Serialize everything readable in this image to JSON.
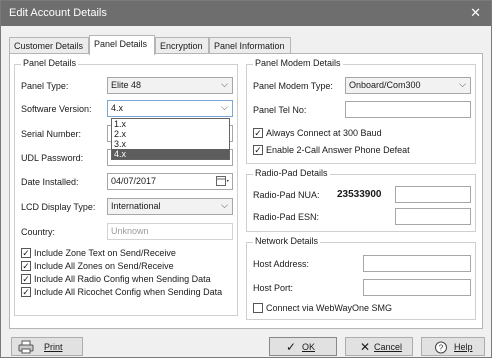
{
  "window": {
    "title": "Edit Account Details",
    "close_glyph": "✕"
  },
  "tabs": [
    {
      "label": "Customer Details"
    },
    {
      "label": "Panel Details"
    },
    {
      "label": "Encryption"
    },
    {
      "label": "Panel Information"
    }
  ],
  "panel_details": {
    "group_title": "Panel Details",
    "panel_type": {
      "label": "Panel Type:",
      "value": "Elite 48"
    },
    "software_version": {
      "label": "Software Version:",
      "value": "4.x",
      "options": [
        "1.x",
        "2.x",
        "3.x",
        "4.x"
      ],
      "selected": "4.x"
    },
    "serial_number": {
      "label": "Serial Number:"
    },
    "udl_password": {
      "label": "UDL Password:"
    },
    "date_installed": {
      "label": "Date Installed:",
      "value": "04/07/2017"
    },
    "lcd_display_type": {
      "label": "LCD Display Type:",
      "value": "International"
    },
    "country": {
      "label": "Country:",
      "value": "Unknown"
    },
    "checks": [
      {
        "label": "Include Zone Text on Send/Receive",
        "checked": true
      },
      {
        "label": "Include All Zones on Send/Receive",
        "checked": true
      },
      {
        "label": "Include All Radio Config when Sending Data",
        "checked": true
      },
      {
        "label": "Include All Ricochet Config when Sending Data",
        "checked": true
      }
    ]
  },
  "modem_details": {
    "group_title": "Panel Modem Details",
    "modem_type": {
      "label": "Panel Modem Type:",
      "value": "Onboard/Com300"
    },
    "panel_tel": {
      "label": "Panel Tel No:",
      "value": ""
    },
    "checks": [
      {
        "label": "Always Connect at 300 Baud",
        "checked": true
      },
      {
        "label": "Enable 2-Call Answer Phone Defeat",
        "checked": true
      }
    ]
  },
  "radiopad": {
    "group_title": "Radio-Pad Details",
    "nua": {
      "label": "Radio-Pad NUA:",
      "value": "23533900"
    },
    "esn": {
      "label": "Radio-Pad ESN:"
    }
  },
  "network": {
    "group_title": "Network Details",
    "host_address": {
      "label": "Host Address:"
    },
    "host_port": {
      "label": "Host Port:"
    },
    "webwayone": {
      "label": "Connect via WebWayOne SMG",
      "checked": false
    }
  },
  "buttons": {
    "print": "Print",
    "ok": "OK",
    "cancel": "Cancel",
    "help": "Help"
  },
  "check_glyph": "✓"
}
